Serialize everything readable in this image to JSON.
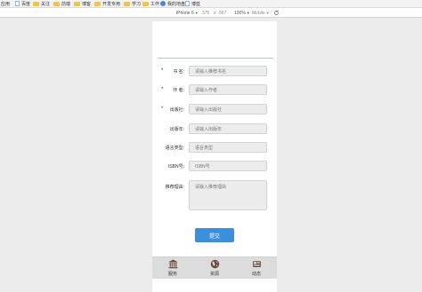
{
  "bookmarks": [
    {
      "label": "应用",
      "icon": "apps-grid-icon"
    },
    {
      "label": "百度",
      "icon": "page-icon"
    },
    {
      "label": "关注",
      "icon": "folder-icon"
    },
    {
      "label": "前端",
      "icon": "folder-icon"
    },
    {
      "label": "博客",
      "icon": "folder-icon"
    },
    {
      "label": "开发专用",
      "icon": "folder-icon"
    },
    {
      "label": "学习",
      "icon": "folder-icon"
    },
    {
      "label": "工作",
      "icon": "folder-icon"
    },
    {
      "label": "我的地盘",
      "icon": "globe-icon"
    },
    {
      "label": "博蓝",
      "icon": "page-icon"
    }
  ],
  "device_toolbar": {
    "device": "iPhone 6",
    "width": "375",
    "times": "x",
    "height": "667",
    "zoom": "100%",
    "mode": "Mobile"
  },
  "form": {
    "fields": [
      {
        "required": "*",
        "label": "书  名:",
        "placeholder": "请输入推荐书名"
      },
      {
        "required": "*",
        "label": "作  者:",
        "placeholder": "请输入作者"
      },
      {
        "required": "*",
        "label": "出版社:",
        "placeholder": "请输入出版社"
      },
      {
        "required": "",
        "label": "出版年:",
        "placeholder": "请输入出版年"
      },
      {
        "required": "",
        "label": "语言类型:",
        "placeholder": "语言类型"
      },
      {
        "required": "",
        "label": "ISBN号:",
        "placeholder": "ISBN号"
      }
    ],
    "reason": {
      "label": "推荐理由:",
      "placeholder": "请输入推荐理由"
    },
    "submit_label": "提交"
  },
  "tabs": [
    {
      "label": "服务",
      "icon": "bank-building-icon"
    },
    {
      "label": "资源",
      "icon": "globe-icon"
    },
    {
      "label": "动态",
      "icon": "newspaper-icon"
    }
  ],
  "colors": {
    "accent": "#3e8fdb",
    "tab_icon": "#6b4a3a",
    "field_bg": "#ececec"
  }
}
